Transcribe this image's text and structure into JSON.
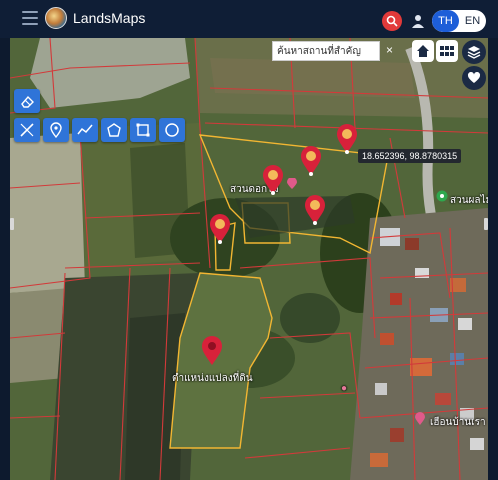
{
  "header": {
    "app_title": "LandsMaps",
    "lang_options": [
      "TH",
      "EN"
    ],
    "lang_active": "TH",
    "icons": [
      "menu-icon",
      "logo",
      "search-icon",
      "user-icon"
    ]
  },
  "search": {
    "placeholder": "ค้นหาสถานที่สำคัญ",
    "clear_label": "×"
  },
  "map": {
    "coordinate_label": "18.652396, 98.8780315",
    "parcel_label": "ตำแหน่งแปลงที่ดิน",
    "place_labels": [
      "สวนผลไม้",
      "เฮือนบ้านเรา",
      "สวนดอกไม้"
    ],
    "tools": [
      "eraser-icon",
      "edit-tools-icon",
      "pin-icon",
      "polyline-icon",
      "polygon-icon",
      "rectangle-icon",
      "circle-icon"
    ],
    "right_controls": [
      "home-icon",
      "grid-icon",
      "layers-icon",
      "heart-icon"
    ],
    "colors": {
      "header_bg": "#0f1e36",
      "accent_blue": "#1d5ed8",
      "tool_blue": "#2f74d8",
      "search_red": "#e23a3a",
      "parcel_line": "#f2b632",
      "boundary_line": "#d23a3a",
      "marker_red": "#d8213a",
      "marker_dot": "#f3b95a"
    }
  }
}
